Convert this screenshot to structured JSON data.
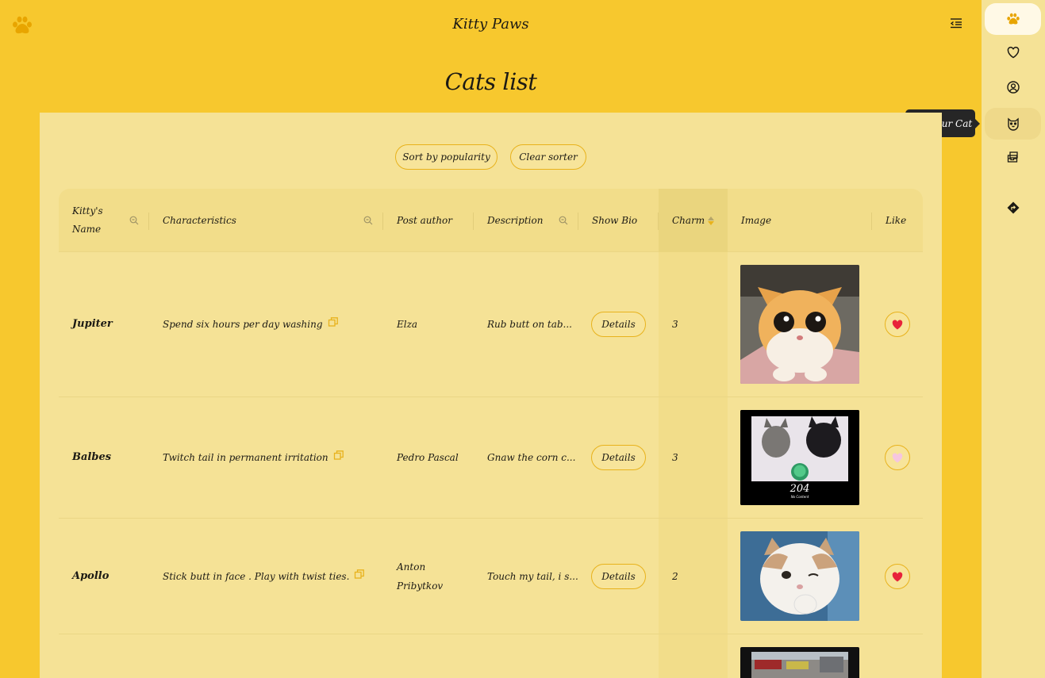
{
  "app": {
    "title": "Kitty Paws",
    "logo_icon": "paw-icon"
  },
  "page": {
    "title": "Cats list"
  },
  "sidebar": {
    "items": [
      {
        "icon": "paw-icon",
        "active": true
      },
      {
        "icon": "heart-icon"
      },
      {
        "icon": "user-circle-icon"
      },
      {
        "icon": "cat-face-icon",
        "tooltip": "Add Your Cat"
      },
      {
        "icon": "inbox-icon"
      },
      {
        "icon": "directions-icon"
      }
    ]
  },
  "sorters": {
    "popularity": "Sort by popularity",
    "clear": "Clear sorter"
  },
  "table": {
    "columns": {
      "name": "Kitty's Name",
      "characteristics": "Characteristics",
      "author": "Post author",
      "description": "Description",
      "bio": "Show Bio",
      "charm": "Charm",
      "image": "Image",
      "like": "Like"
    },
    "rows": [
      {
        "name": "Jupiter",
        "characteristics": "Spend six hours per day washing",
        "author": "Elza",
        "description": "Rub butt on tab...",
        "bio_button": "Details",
        "charm": "3",
        "liked": true
      },
      {
        "name": "Balbes",
        "characteristics": "Twitch tail in permanent irritation",
        "author": "Pedro Pascal",
        "description": "Gnaw the corn c...",
        "bio_button": "Details",
        "charm": "3",
        "liked": false,
        "image_caption": "204",
        "image_subcaption": "No Content"
      },
      {
        "name": "Apollo",
        "characteristics": "Stick butt in face . Play with twist ties.",
        "author": "Anton Pribytkov",
        "description": "Touch my tail, i s...",
        "bio_button": "Details",
        "charm": "2",
        "liked": true
      }
    ]
  },
  "colors": {
    "background": "#f7c82e",
    "panel": "#f5e296",
    "accent": "#e8b21c",
    "like": "#e8233a"
  }
}
